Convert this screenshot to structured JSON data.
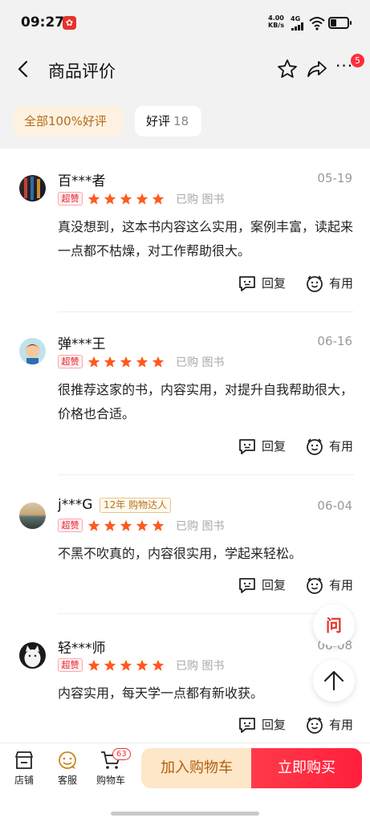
{
  "status_bar": {
    "time": "09:27",
    "net_speed_value": "4.00",
    "net_speed_unit": "KB/s",
    "network": "4G",
    "icons": [
      "app-notification-icon",
      "signal-icon",
      "wifi-icon",
      "battery-icon"
    ]
  },
  "nav": {
    "title": "商品评价",
    "more_badge": "5",
    "icons": [
      "back-icon",
      "star-icon",
      "share-icon",
      "more-icon"
    ]
  },
  "filters": {
    "all_label": "全部100%好评",
    "good_label": "好评",
    "good_count": "18"
  },
  "reviews": [
    {
      "user": "百***者",
      "date": "05-19",
      "badge": "超赞",
      "rating": 5,
      "purchased": "已购 图书",
      "content": "真没想到，这本书内容这么实用，案例丰富，读起来一点都不枯燥，对工作帮助很大。",
      "reply_label": "回复",
      "useful_label": "有用"
    },
    {
      "user": "弹***王",
      "date": "06-16",
      "badge": "超赞",
      "rating": 5,
      "purchased": "已购 图书",
      "content": "很推荐这家的书，内容实用，对提升自我帮助很大，价格也合适。",
      "reply_label": "回复",
      "useful_label": "有用"
    },
    {
      "user": "j***G",
      "date": "06-04",
      "badge": "超赞",
      "member_tag": "12年 购物达人",
      "rating": 5,
      "purchased": "已购 图书",
      "content": "不黑不吹真的，内容很实用，学起来轻松。",
      "reply_label": "回复",
      "useful_label": "有用"
    },
    {
      "user": "轻***师",
      "date": "06-08",
      "badge": "超赞",
      "rating": 5,
      "purchased": "已购 图书",
      "content": "内容实用，每天学一点都有新收获。",
      "reply_label": "回复",
      "useful_label": "有用"
    }
  ],
  "floating": {
    "ask_label": "问",
    "icons": [
      "ask-icon",
      "scroll-top-icon"
    ]
  },
  "bottom_bar": {
    "store_label": "店铺",
    "service_label": "客服",
    "cart_label": "购物车",
    "cart_count": "63",
    "add_to_cart": "加入购物车",
    "buy_now": "立即购买"
  },
  "colors": {
    "accent_red": "#ff2d3b",
    "star_orange": "#ff5a1f",
    "gold_text": "#b36b12",
    "add_cart_bg": "#fde7c8"
  }
}
